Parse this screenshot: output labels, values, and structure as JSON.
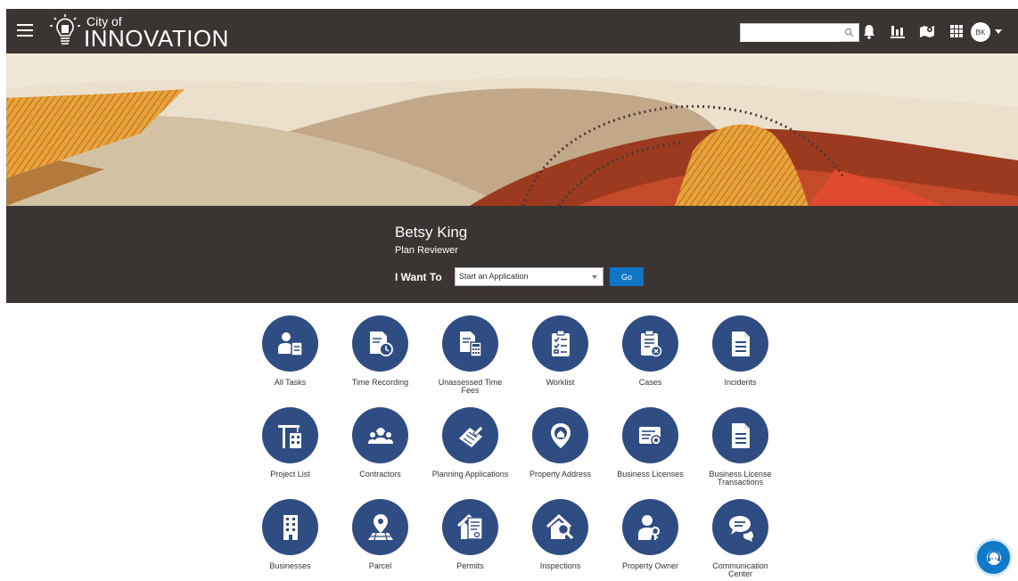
{
  "header": {
    "logo_small": "City of",
    "logo_big": "INNOVATION",
    "search_value": "",
    "search_placeholder": "",
    "avatar_initials": "BK",
    "icons": [
      "menu-icon",
      "bell-icon",
      "chart-icon",
      "map-icon",
      "grid-icon",
      "avatar"
    ]
  },
  "profile": {
    "name": "Betsy King",
    "role": "Plan Reviewer",
    "i_want_label": "I Want To",
    "selected_option": "Start an Application",
    "go_label": "Go"
  },
  "tiles": [
    {
      "label": "All Tasks",
      "icon": "user-document-icon"
    },
    {
      "label": "Time Recording",
      "icon": "timesheet-clock-icon"
    },
    {
      "label": "Unassessed Time Fees",
      "icon": "document-calculator-icon"
    },
    {
      "label": "Worklist",
      "icon": "clipboard-checklist-icon"
    },
    {
      "label": "Cases",
      "icon": "clipboard-badge-icon"
    },
    {
      "label": "Incidents",
      "icon": "document-icon"
    },
    {
      "label": "Project List",
      "icon": "crane-building-icon"
    },
    {
      "label": "Contractors",
      "icon": "workers-group-icon"
    },
    {
      "label": "Planning Applications",
      "icon": "blueprint-pencil-icon"
    },
    {
      "label": "Property Address",
      "icon": "location-home-icon"
    },
    {
      "label": "Business Licenses",
      "icon": "license-certificate-icon"
    },
    {
      "label": "Business License Transactions",
      "icon": "document-icon"
    },
    {
      "label": "Businesses",
      "icon": "office-building-icon"
    },
    {
      "label": "Parcel",
      "icon": "map-pin-parcel-icon"
    },
    {
      "label": "Permits",
      "icon": "house-permit-icon"
    },
    {
      "label": "Inspections",
      "icon": "house-magnifier-icon"
    },
    {
      "label": "Property Owner",
      "icon": "person-key-icon"
    },
    {
      "label": "Communication Center",
      "icon": "chat-bubbles-icon"
    }
  ],
  "colors": {
    "header_bg": "#3a3432",
    "tile_circle": "#2f4d82",
    "go_button": "#0f75c4",
    "chat_button": "#1278c8"
  }
}
